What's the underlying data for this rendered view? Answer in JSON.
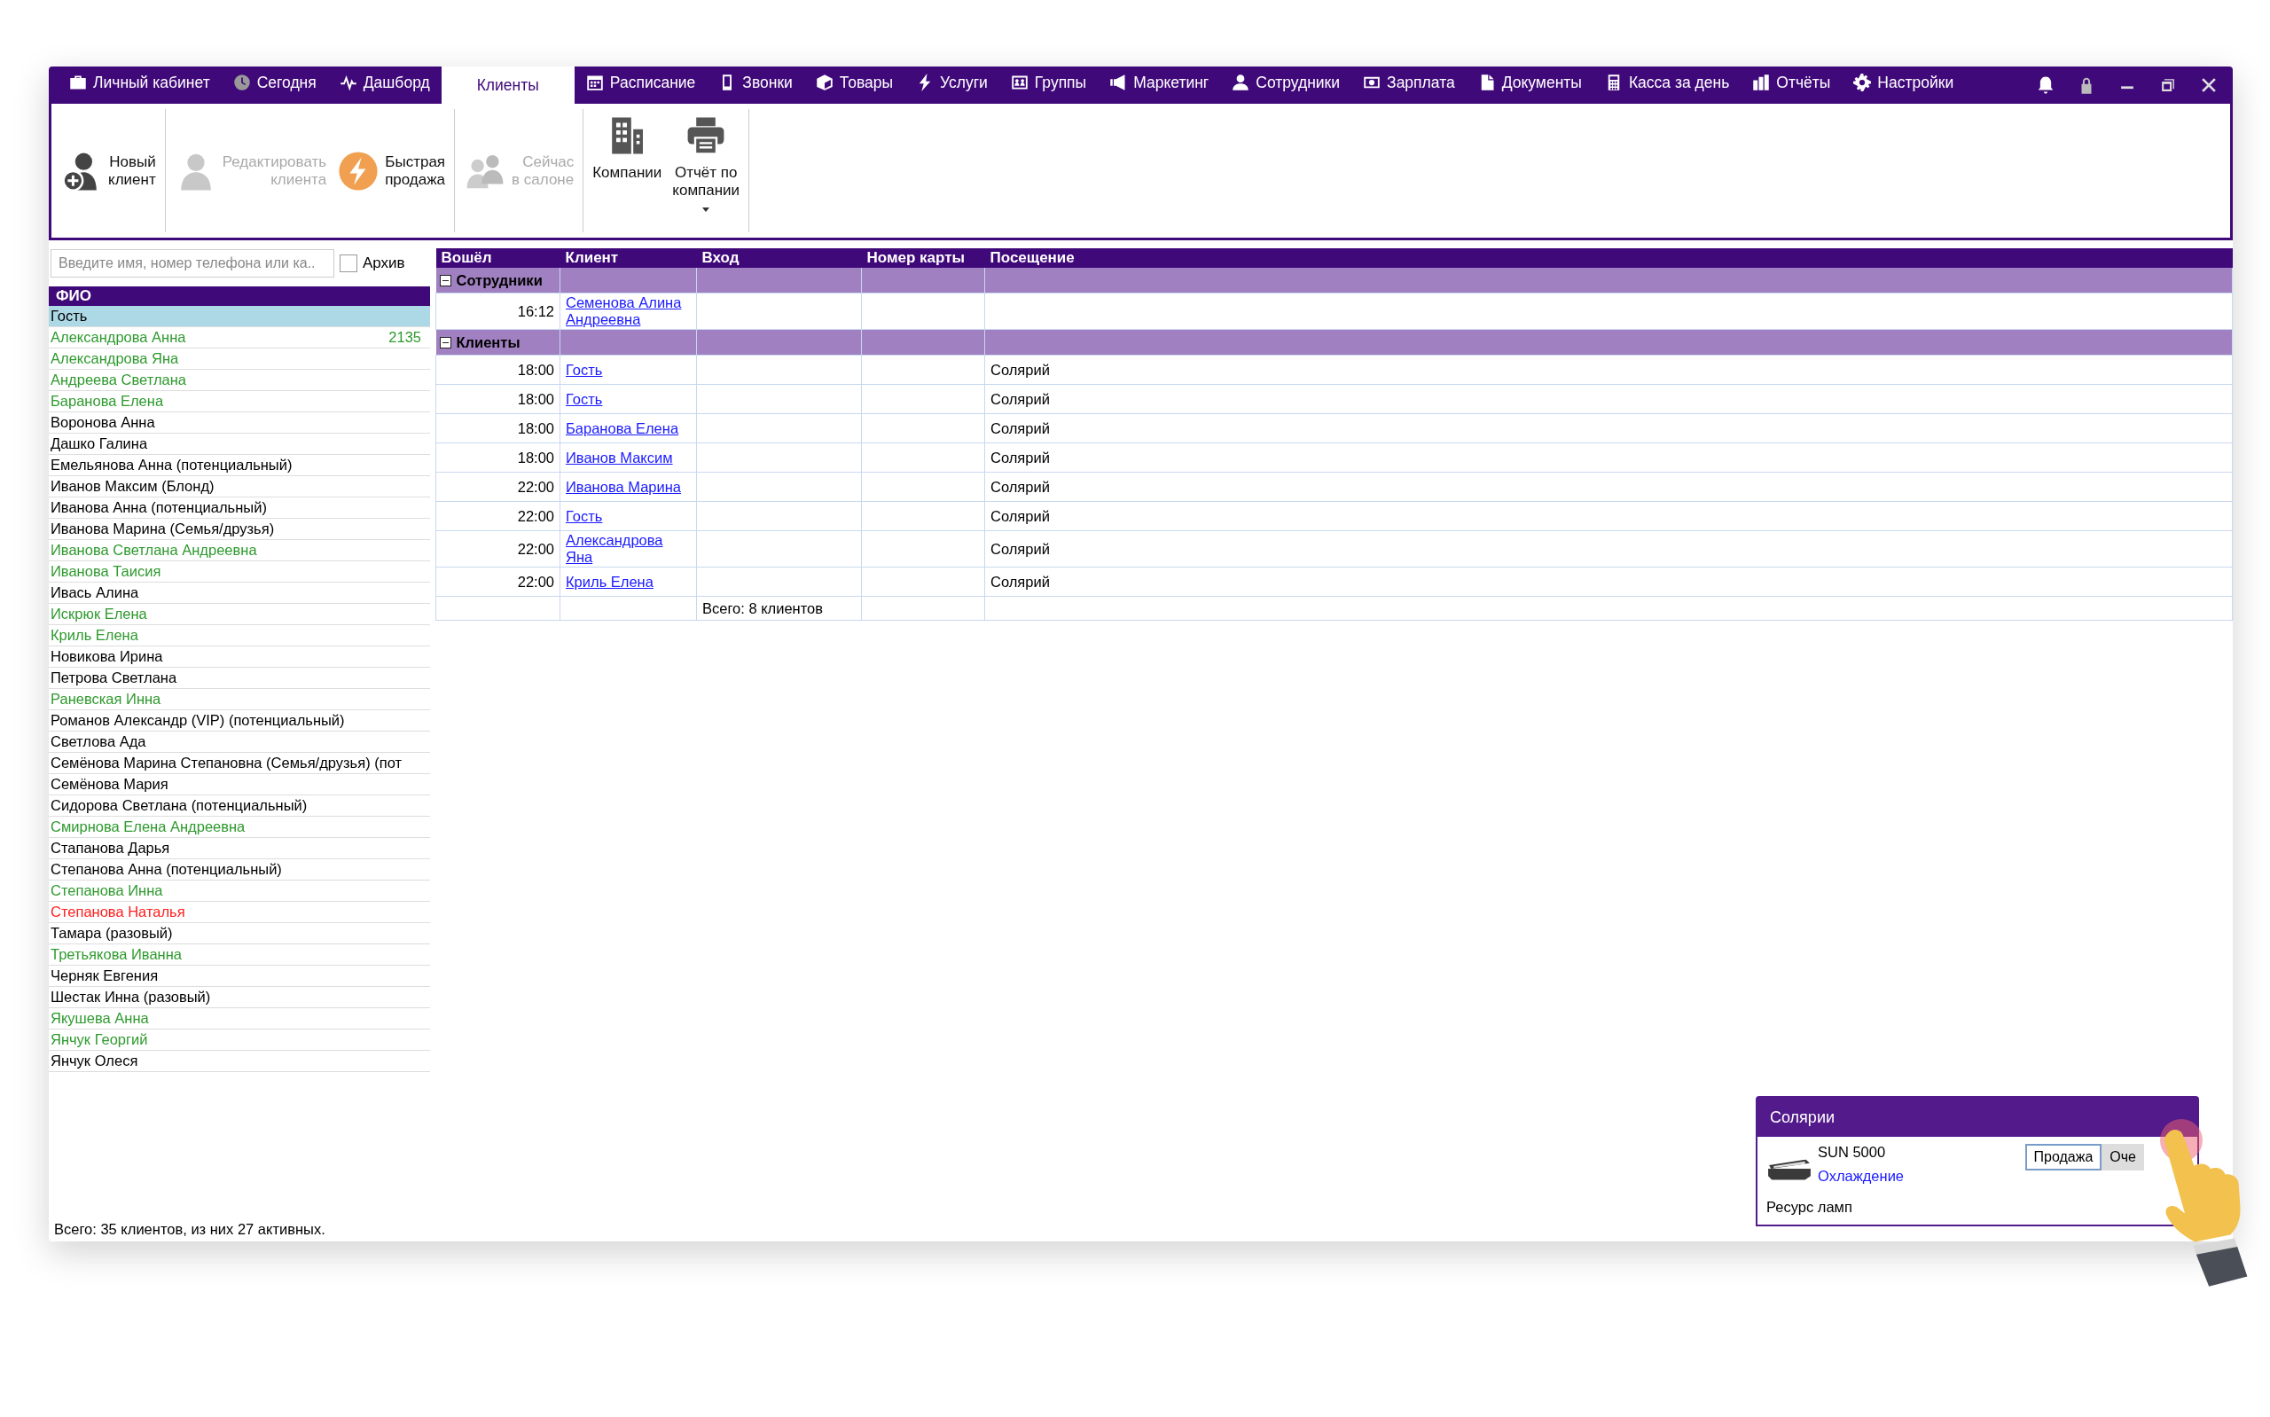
{
  "nav_tabs": [
    {
      "label": "Личный кабинет",
      "selected": false
    },
    {
      "label": "Сегодня",
      "selected": false
    },
    {
      "label": "Дашборд",
      "selected": false
    },
    {
      "label": "Клиенты",
      "selected": true
    },
    {
      "label": "Расписание",
      "selected": false
    },
    {
      "label": "Звонки",
      "selected": false
    },
    {
      "label": "Товары",
      "selected": false
    },
    {
      "label": "Услуги",
      "selected": false
    },
    {
      "label": "Группы",
      "selected": false
    },
    {
      "label": "Маркетинг",
      "selected": false
    },
    {
      "label": "Сотрудники",
      "selected": false
    },
    {
      "label": "Зарплата",
      "selected": false
    },
    {
      "label": "Документы",
      "selected": false
    },
    {
      "label": "Касса за день",
      "selected": false
    },
    {
      "label": "Отчёты",
      "selected": false
    },
    {
      "label": "Настройки",
      "selected": false
    }
  ],
  "ribbon": {
    "groups": [
      [
        {
          "label": "Новый\nклиент",
          "kind": "side",
          "disabled": false,
          "dropdown": false
        }
      ],
      [
        {
          "label": "Редактировать\nклиента",
          "kind": "side",
          "disabled": true,
          "dropdown": false
        },
        {
          "label": "Быстрая\nпродажа",
          "kind": "side",
          "disabled": false,
          "dropdown": false
        }
      ],
      [
        {
          "label": "Сейчас\nв салоне",
          "kind": "side",
          "disabled": true,
          "dropdown": false
        }
      ],
      [
        {
          "label": "Компании",
          "kind": "stacked",
          "disabled": false,
          "dropdown": false
        },
        {
          "label": "Отчёт по\nкомпании",
          "kind": "stacked",
          "disabled": false,
          "dropdown": true
        }
      ]
    ]
  },
  "client_list": {
    "search": {
      "placeholder": "Введите имя, номер телефона или ка.."
    },
    "archive": {
      "label": "Архив",
      "checked": false
    },
    "column": "ФИО",
    "clients": [
      {
        "name": "Гость",
        "color": "#000000",
        "selected": true
      },
      {
        "name": "Александрова Анна",
        "color": "#2f9a2f",
        "selected": false,
        "card": "2135"
      },
      {
        "name": "Александрова Яна",
        "color": "#2f9a2f",
        "selected": false
      },
      {
        "name": "Андреева Светлана",
        "color": "#2f9a2f",
        "selected": false
      },
      {
        "name": "Баранова Елена",
        "color": "#2f9a2f",
        "selected": false
      },
      {
        "name": "Воронова Анна",
        "color": "#000000",
        "selected": false
      },
      {
        "name": "Дашко Галина",
        "color": "#000000",
        "selected": false
      },
      {
        "name": "Емельянова Анна (потенциальный)",
        "color": "#000000",
        "selected": false
      },
      {
        "name": "Иванов Максим (Блонд)",
        "color": "#000000",
        "selected": false
      },
      {
        "name": "Иванова Анна (потенциальный)",
        "color": "#000000",
        "selected": false
      },
      {
        "name": "Иванова Марина (Семья/друзья)",
        "color": "#000000",
        "selected": false
      },
      {
        "name": "Иванова Светлана Андреевна",
        "color": "#2f9a2f",
        "selected": false
      },
      {
        "name": "Иванова Таисия",
        "color": "#2f9a2f",
        "selected": false
      },
      {
        "name": "Ивась Алина",
        "color": "#000000",
        "selected": false
      },
      {
        "name": "Искрюк Елена",
        "color": "#2f9a2f",
        "selected": false
      },
      {
        "name": "Криль Елена",
        "color": "#2f9a2f",
        "selected": false
      },
      {
        "name": "Новикова Ирина",
        "color": "#000000",
        "selected": false
      },
      {
        "name": "Петрова Светлана",
        "color": "#000000",
        "selected": false
      },
      {
        "name": "Раневская Инна",
        "color": "#2f9a2f",
        "selected": false
      },
      {
        "name": "Романов Александр (VIP) (потенциальный)",
        "color": "#000000",
        "selected": false
      },
      {
        "name": "Светлова Ада",
        "color": "#000000",
        "selected": false
      },
      {
        "name": "Семёнова Марина Степановна (Семья/друзья) (пот",
        "color": "#000000",
        "selected": false
      },
      {
        "name": "Семёнова Мария",
        "color": "#000000",
        "selected": false
      },
      {
        "name": "Сидорова Светлана (потенциальный)",
        "color": "#000000",
        "selected": false
      },
      {
        "name": "Смирнова Елена Андреевна",
        "color": "#2f9a2f",
        "selected": false
      },
      {
        "name": "Стапанова Дарья",
        "color": "#000000",
        "selected": false
      },
      {
        "name": "Степанова Анна (потенциальный)",
        "color": "#000000",
        "selected": false
      },
      {
        "name": "Степанова Инна",
        "color": "#2f9a2f",
        "selected": false
      },
      {
        "name": "Степанова Наталья",
        "color": "#ff2020",
        "selected": false
      },
      {
        "name": "Тамара (разовый)",
        "color": "#000000",
        "selected": false
      },
      {
        "name": "Третьякова Иванна",
        "color": "#2f9a2f",
        "selected": false
      },
      {
        "name": "Черняк Евгения",
        "color": "#000000",
        "selected": false
      },
      {
        "name": "Шестак Инна (разовый)",
        "color": "#000000",
        "selected": false
      },
      {
        "name": "Якушева Анна",
        "color": "#2f9a2f",
        "selected": false
      },
      {
        "name": "Янчук Георгий",
        "color": "#2f9a2f",
        "selected": false
      },
      {
        "name": "Янчук Олеся",
        "color": "#000000",
        "selected": false
      }
    ],
    "footer": "Всего: 35 клиентов, из них 27 активных."
  },
  "visits_table": {
    "columns": [
      "Вошёл",
      "Клиент",
      "Вход",
      "Номер карты",
      "Посещение"
    ],
    "groups": [
      {
        "title": "Сотрудники",
        "expanded": true,
        "rows": [
          {
            "time": "16:12",
            "client": "Семенова Алина Андреевна"
          }
        ]
      },
      {
        "title": "Клиенты",
        "expanded": true,
        "rows": [
          {
            "time": "18:00",
            "client": "Гость",
            "visit": "Солярий"
          },
          {
            "time": "18:00",
            "client": "Гость",
            "visit": "Солярий"
          },
          {
            "time": "18:00",
            "client": "Баранова Елена",
            "visit": "Солярий"
          },
          {
            "time": "18:00",
            "client": "Иванов Максим",
            "visit": "Солярий"
          },
          {
            "time": "22:00",
            "client": "Иванова Марина",
            "visit": "Солярий"
          },
          {
            "time": "22:00",
            "client": "Гость",
            "visit": "Солярий"
          },
          {
            "time": "22:00",
            "client": "Александрова Яна",
            "visit": "Солярий"
          },
          {
            "time": "22:00",
            "client": "Криль Елена",
            "visit": "Солярий"
          }
        ]
      }
    ],
    "total": "Всего: 8 клиентов"
  },
  "solarium_panel": {
    "title": "Солярии",
    "device": {
      "name": "SUN 5000",
      "status": "Охлаждение"
    },
    "buttons": [
      "Продажа",
      "Оче"
    ],
    "resource_label": "Ресурс ламп"
  }
}
